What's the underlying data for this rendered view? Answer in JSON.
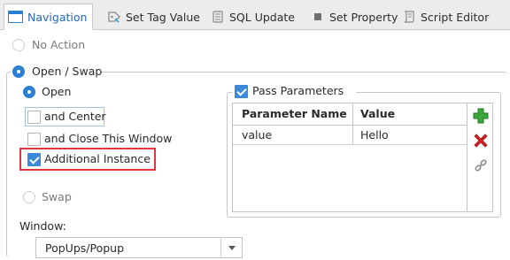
{
  "tabs": [
    {
      "label": "Navigation",
      "icon": "navigation-icon",
      "active": true
    },
    {
      "label": "Set Tag Value",
      "icon": "tag-icon",
      "active": false
    },
    {
      "label": "SQL Update",
      "icon": "database-icon",
      "active": false
    },
    {
      "label": "Set Property",
      "icon": "property-icon",
      "active": false
    },
    {
      "label": "Script Editor",
      "icon": "script-icon",
      "active": false
    }
  ],
  "options": {
    "no_action": "No Action",
    "open_swap": "Open / Swap",
    "open": "Open",
    "and_center": "and Center",
    "and_close": "and Close This Window",
    "additional_instance": "Additional Instance",
    "swap": "Swap"
  },
  "states": {
    "no_action": false,
    "open_swap": true,
    "open": true,
    "and_center": false,
    "and_close": false,
    "additional_instance": true,
    "swap": false,
    "pass_parameters": true
  },
  "params": {
    "title": "Pass Parameters",
    "columns": [
      "Parameter Name",
      "Value"
    ],
    "rows": [
      [
        "value",
        "Hello"
      ]
    ]
  },
  "window": {
    "label": "Window:",
    "value": "PopUps/Popup"
  },
  "colors": {
    "accent": "#2b7fd3",
    "highlight": "#e0363e",
    "add": "#3aa53a",
    "delete": "#d42020"
  }
}
